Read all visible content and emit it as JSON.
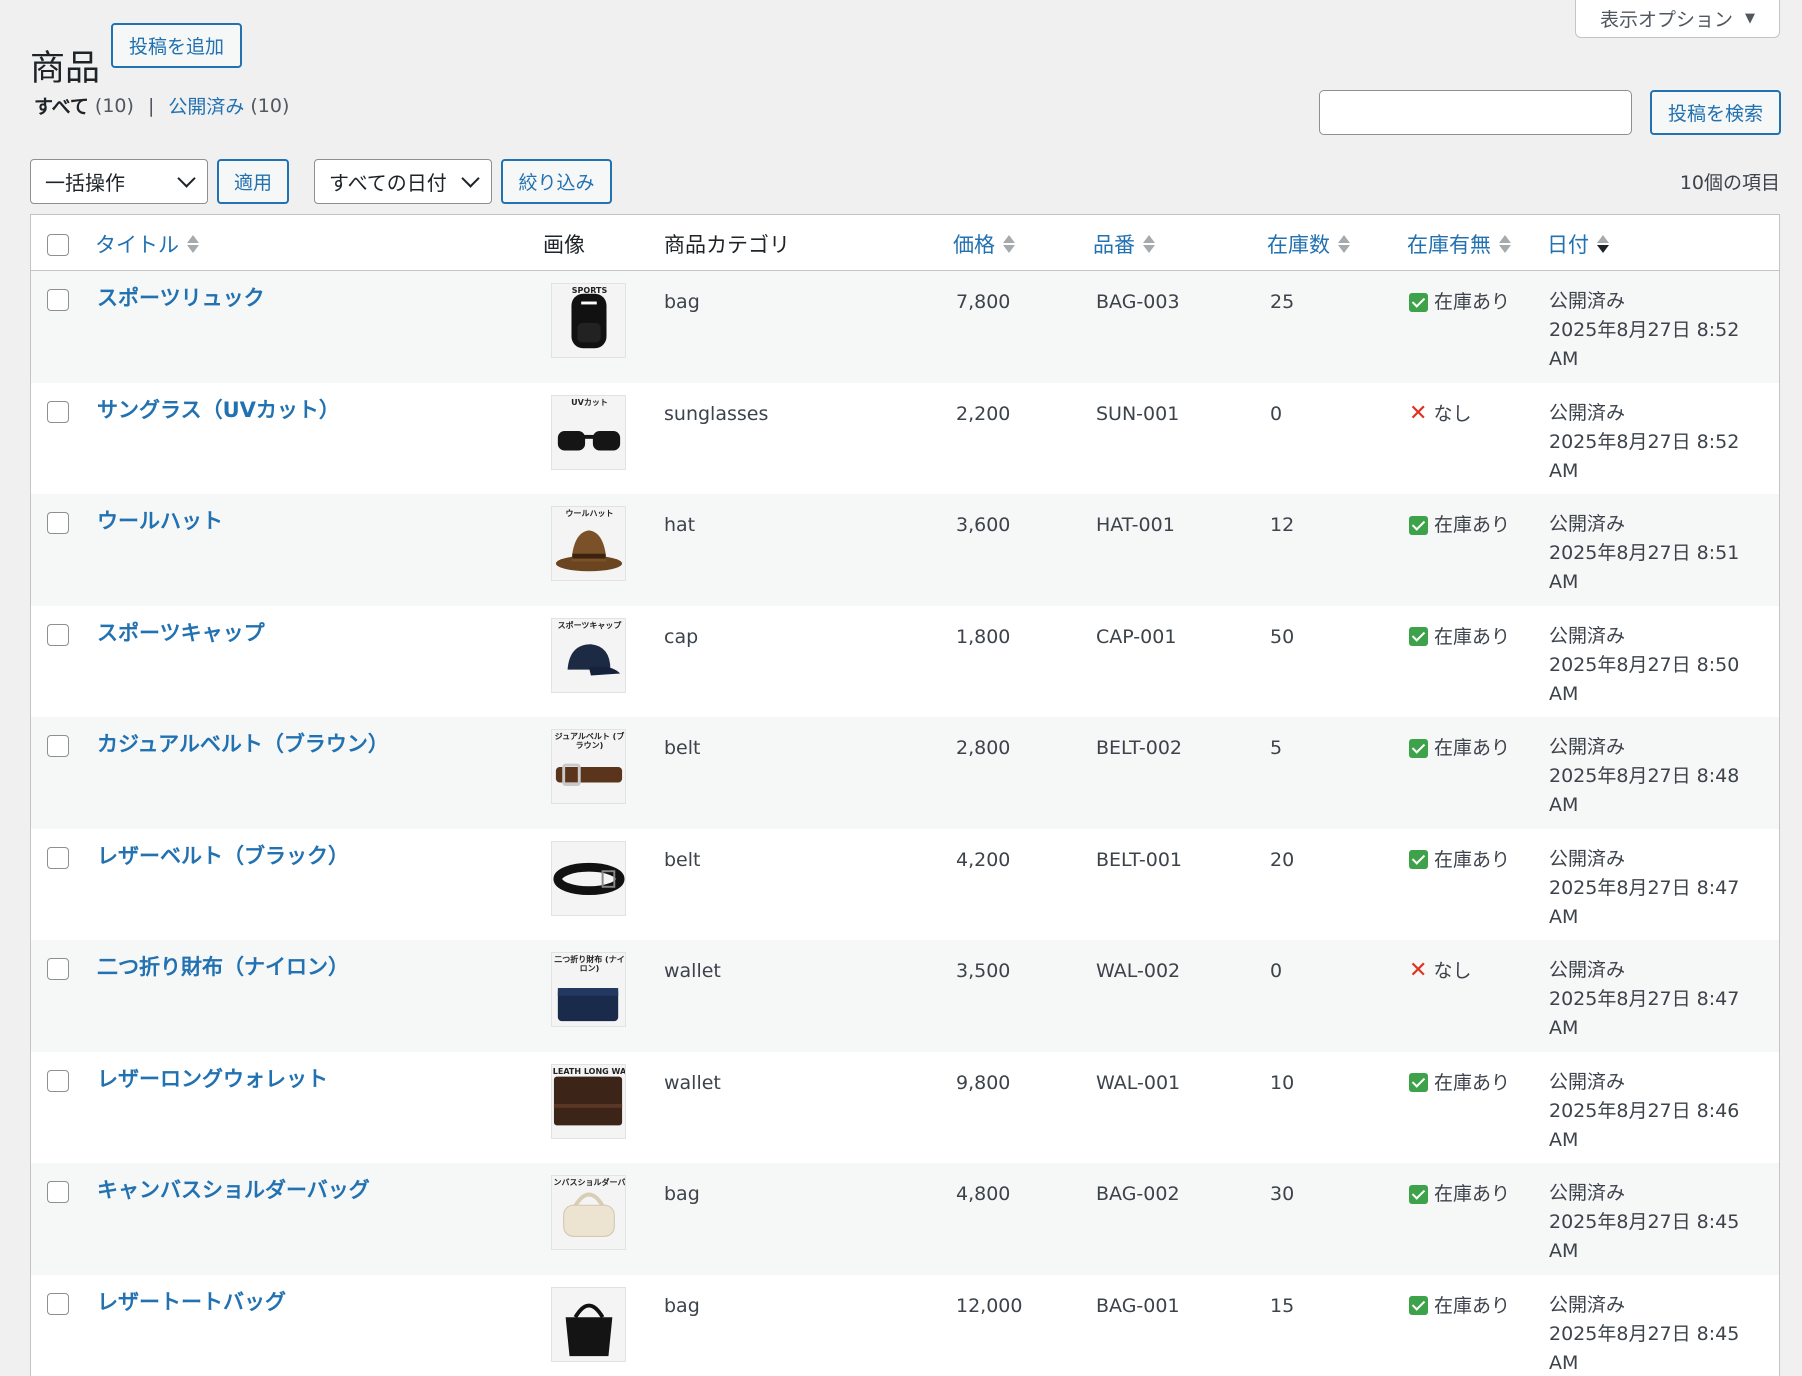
{
  "screen_options_label": "表示オプション",
  "page_title": "商品",
  "add_new_label": "投稿を追加",
  "views": {
    "all_label": "すべて",
    "all_count": "(10)",
    "separator": "|",
    "published_label": "公開済み",
    "published_count": "(10)"
  },
  "search": {
    "button_label": "投稿を検索",
    "value": ""
  },
  "bulk_actions": {
    "selected": "一括操作",
    "apply_label": "適用"
  },
  "date_filter": {
    "selected": "すべての日付",
    "filter_label": "絞り込み"
  },
  "item_count": "10個の項目",
  "columns": {
    "title": "タイトル",
    "image": "画像",
    "category": "商品カテゴリ",
    "price": "価格",
    "sku": "品番",
    "stock_qty": "在庫数",
    "stock_status": "在庫有無",
    "date": "日付"
  },
  "rows": [
    {
      "title": "スポーツリュック",
      "image": "backpack",
      "thumb_caption": "SPORTS",
      "category": "bag",
      "price": "7,800",
      "sku": "BAG-003",
      "qty": "25",
      "status": "在庫あり",
      "in_stock": true,
      "date_status": "公開済み",
      "date": "2025年8月27日 8:52",
      "ampm": "AM"
    },
    {
      "title": "サングラス（UVカット）",
      "image": "sunglasses",
      "thumb_caption": "UVカット",
      "category": "sunglasses",
      "price": "2,200",
      "sku": "SUN-001",
      "qty": "0",
      "status": "なし",
      "in_stock": false,
      "date_status": "公開済み",
      "date": "2025年8月27日 8:52",
      "ampm": "AM"
    },
    {
      "title": "ウールハット",
      "image": "hat",
      "thumb_caption": "ウールハット",
      "category": "hat",
      "price": "3,600",
      "sku": "HAT-001",
      "qty": "12",
      "status": "在庫あり",
      "in_stock": true,
      "date_status": "公開済み",
      "date": "2025年8月27日 8:51",
      "ampm": "AM"
    },
    {
      "title": "スポーツキャップ",
      "image": "cap",
      "thumb_caption": "スポーツキャップ",
      "category": "cap",
      "price": "1,800",
      "sku": "CAP-001",
      "qty": "50",
      "status": "在庫あり",
      "in_stock": true,
      "date_status": "公開済み",
      "date": "2025年8月27日 8:50",
      "ampm": "AM"
    },
    {
      "title": "カジュアルベルト（ブラウン）",
      "image": "belt-brown",
      "thumb_caption": "ジュアルベルト (ブラウン)",
      "category": "belt",
      "price": "2,800",
      "sku": "BELT-002",
      "qty": "5",
      "status": "在庫あり",
      "in_stock": true,
      "date_status": "公開済み",
      "date": "2025年8月27日 8:48",
      "ampm": "AM"
    },
    {
      "title": "レザーベルト（ブラック）",
      "image": "belt-black",
      "thumb_caption": "",
      "category": "belt",
      "price": "4,200",
      "sku": "BELT-001",
      "qty": "20",
      "status": "在庫あり",
      "in_stock": true,
      "date_status": "公開済み",
      "date": "2025年8月27日 8:47",
      "ampm": "AM"
    },
    {
      "title": "二つ折り財布（ナイロン）",
      "image": "wallet-navy",
      "thumb_caption": "二つ折り財布 (ナイロン)",
      "category": "wallet",
      "price": "3,500",
      "sku": "WAL-002",
      "qty": "0",
      "status": "なし",
      "in_stock": false,
      "date_status": "公開済み",
      "date": "2025年8月27日 8:47",
      "ampm": "AM"
    },
    {
      "title": "レザーロングウォレット",
      "image": "wallet-long",
      "thumb_caption": "LEATH LONG WA",
      "category": "wallet",
      "price": "9,800",
      "sku": "WAL-001",
      "qty": "10",
      "status": "在庫あり",
      "in_stock": true,
      "date_status": "公開済み",
      "date": "2025年8月27日 8:46",
      "ampm": "AM"
    },
    {
      "title": "キャンバスショルダーバッグ",
      "image": "shoulder-bag",
      "thumb_caption": "ンバスショルダーバ",
      "category": "bag",
      "price": "4,800",
      "sku": "BAG-002",
      "qty": "30",
      "status": "在庫あり",
      "in_stock": true,
      "date_status": "公開済み",
      "date": "2025年8月27日 8:45",
      "ampm": "AM"
    },
    {
      "title": "レザートートバッグ",
      "image": "tote-bag",
      "thumb_caption": "",
      "category": "bag",
      "price": "12,000",
      "sku": "BAG-001",
      "qty": "15",
      "status": "在庫あり",
      "in_stock": true,
      "date_status": "公開済み",
      "date": "2025年8月27日 8:45",
      "ampm": "AM"
    }
  ]
}
